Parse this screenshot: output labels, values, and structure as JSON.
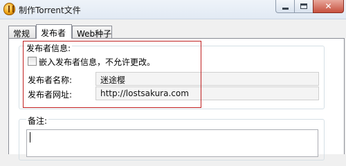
{
  "window": {
    "title": "制作Torrent文件",
    "icon": "app-icon",
    "controls": {
      "minimize": "",
      "maximize": "",
      "close": "✕"
    }
  },
  "tabs": [
    {
      "label": "常规",
      "active": false
    },
    {
      "label": "发布者",
      "active": true
    },
    {
      "label": "Web种子",
      "active": false
    }
  ],
  "publisher_info": {
    "group_title": "发布者信息:",
    "embed_checkbox": {
      "label": "嵌入发布者信息，不允许更改。",
      "checked": false
    },
    "name_label": "发布者名称:",
    "name_value": "迷途樱",
    "url_label": "发布者网址:",
    "url_value": "http://lostsakura.com"
  },
  "notes": {
    "group_title": "备注:",
    "value": ""
  },
  "colors": {
    "highlight_border": "#c02020",
    "panel_background": "#ffffff",
    "window_background": "#f0f0f0"
  }
}
